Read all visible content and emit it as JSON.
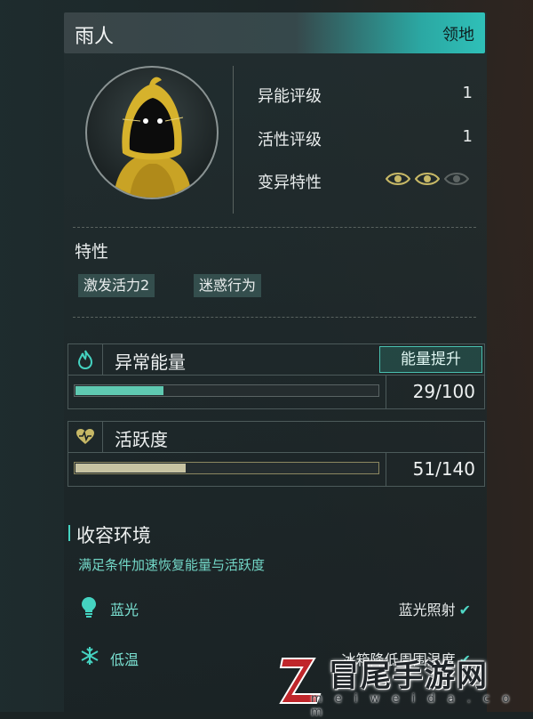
{
  "header": {
    "title": "雨人",
    "badge": "领地"
  },
  "stats": [
    {
      "label": "异能评级",
      "value": "1"
    },
    {
      "label": "活性评级",
      "value": "1"
    },
    {
      "label": "变异特性",
      "eyes_active": 2,
      "eyes_total": 3
    }
  ],
  "traits": {
    "title": "特性",
    "tags": [
      "激发活力2",
      "迷惑行为"
    ]
  },
  "energy": {
    "icon": "flame-icon",
    "title": "异常能量",
    "button": "能量提升",
    "value_text": "29/100",
    "current": 29,
    "max": 100,
    "color": "#5fc9b1"
  },
  "vitality": {
    "icon": "heart-pulse-icon",
    "title": "活跃度",
    "value_text": "51/140",
    "current": 51,
    "max": 140,
    "color": "#c7c3a2"
  },
  "environment": {
    "title": "收容环境",
    "description": "满足条件加速恢复能量与活跃度",
    "conditions": [
      {
        "icon": "lightbulb-icon",
        "label": "蓝光",
        "status": "蓝光照射"
      },
      {
        "icon": "snowflake-icon",
        "label": "低温",
        "status": "冰箱降低周围温度"
      }
    ]
  },
  "watermark": {
    "text": "冒尾手游网",
    "url": "m e i w e i d a . c o m"
  },
  "colors": {
    "accent": "#2fc0b8",
    "eye_active": "#c7b866",
    "eye_inactive": "#5d6463"
  }
}
